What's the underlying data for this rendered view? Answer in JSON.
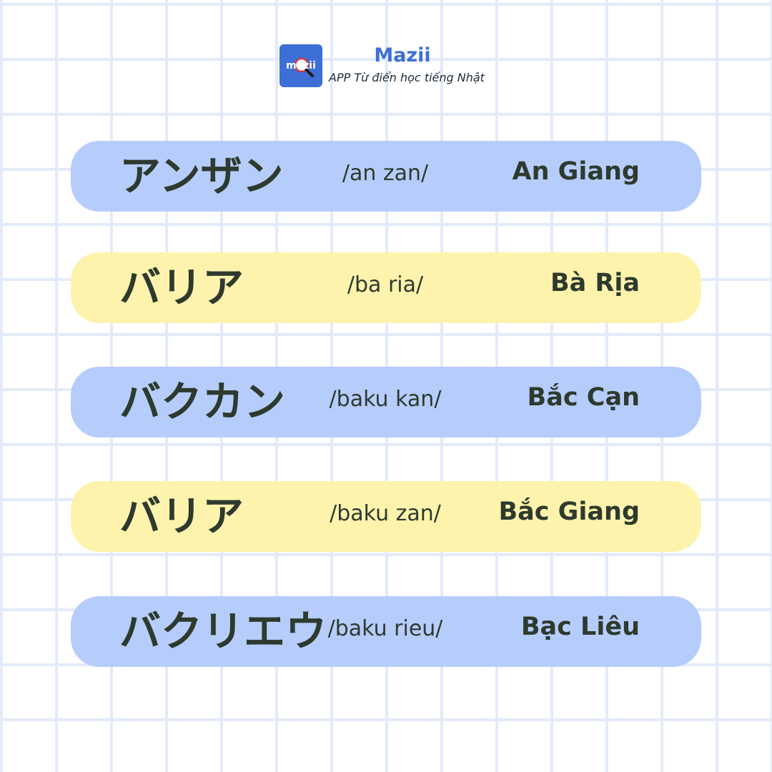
{
  "brand": {
    "logo_text": "mazii",
    "name": "Mazii",
    "tagline": "APP Từ điển học tiếng Nhật"
  },
  "colors": {
    "accent": "#3d6fd6",
    "card_blue": "#b6cdfc",
    "card_yellow": "#fdf3ad",
    "text_dark": "#2e3a2e",
    "grid_line": "#e3ebfa"
  },
  "icons": {
    "logo": "magnifier-icon"
  },
  "rows": [
    {
      "katakana": "アンザン",
      "reading": "/an zan/",
      "place": "An Giang",
      "color": "blue"
    },
    {
      "katakana": "バリア",
      "reading": "/ba ria/",
      "place": "Bà Rịa",
      "color": "yellow"
    },
    {
      "katakana": "バクカン",
      "reading": "/baku kan/",
      "place": "Bắc Cạn",
      "color": "blue"
    },
    {
      "katakana": "バリア",
      "reading": "/baku zan/",
      "place": "Bắc Giang",
      "color": "yellow"
    },
    {
      "katakana": "バクリエウ",
      "reading": "/baku rieu/",
      "place": "Bạc Liêu",
      "color": "blue"
    }
  ]
}
